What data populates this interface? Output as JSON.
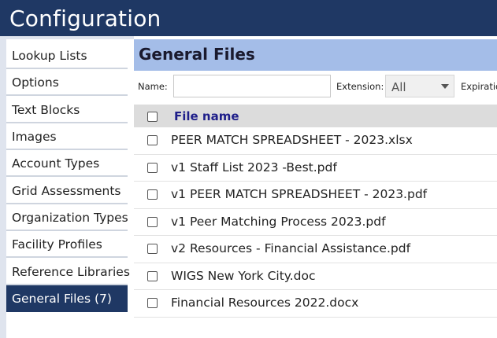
{
  "app": {
    "title": "Configuration"
  },
  "sidebar": {
    "items": [
      {
        "label": "Lookup Lists"
      },
      {
        "label": "Options"
      },
      {
        "label": "Text Blocks"
      },
      {
        "label": "Images"
      },
      {
        "label": "Account Types"
      },
      {
        "label": "Grid Assessments"
      },
      {
        "label": "Organization Types"
      },
      {
        "label": "Facility Profiles"
      },
      {
        "label": "Reference Libraries"
      },
      {
        "label": "General Files (7)",
        "active": true
      }
    ]
  },
  "panel": {
    "title": "General Files",
    "filters": {
      "name_label": "Name:",
      "name_value": "",
      "extension_label": "Extension:",
      "extension_value": "All",
      "expiration_label": "Expiratio"
    },
    "grid": {
      "column_header": "File name",
      "rows": [
        {
          "name": "PEER MATCH SPREADSHEET - 2023.xlsx"
        },
        {
          "name": "v1 Staff List 2023 -Best.pdf"
        },
        {
          "name": "v1 PEER MATCH SPREADSHEET - 2023.pdf"
        },
        {
          "name": "v1 Peer Matching Process 2023.pdf"
        },
        {
          "name": "v2 Resources - Financial Assistance.pdf"
        },
        {
          "name": "WIGS New York City.doc"
        },
        {
          "name": "Financial Resources 2022.docx"
        }
      ]
    }
  },
  "colors": {
    "header_bg": "#1f3864",
    "panel_header_bg": "#a4bde8",
    "sidebar_active_bg": "#1f3864",
    "grid_header_bg": "#dcdcdc",
    "column_header_text": "#1f1f8a"
  }
}
